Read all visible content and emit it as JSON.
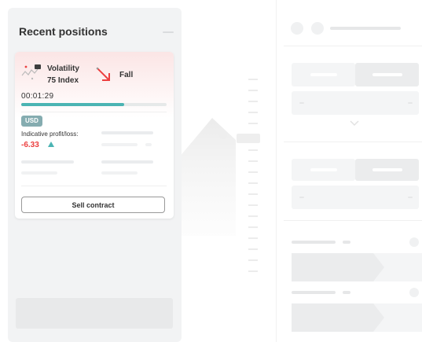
{
  "recent_positions": {
    "title": "Recent positions",
    "card": {
      "symbol_line1": "Volatility",
      "symbol_line2": "75 Index",
      "contract_type": "Fall",
      "timer": "00:01:29",
      "progress": 0.71,
      "currency": "USD",
      "profit_loss_label": "Indicative profit/loss:",
      "profit_loss_value": "-6.33",
      "sell_button_label": "Sell contract"
    }
  },
  "colors": {
    "loss": "#ec3f3f",
    "progress": "#4bb4b3",
    "badge": "#85acb0"
  },
  "icons": {
    "symbol": "synthetic-index-icon",
    "flag": "flag-icon",
    "contract": "fall-arrow-icon",
    "trend": "up-triangle-icon"
  }
}
